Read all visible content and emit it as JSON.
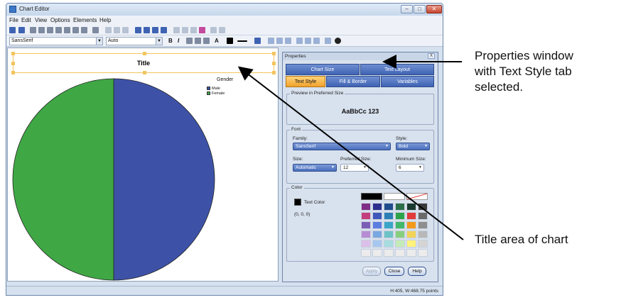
{
  "window": {
    "title": "Chart Editor",
    "controls": {
      "minimize": "–",
      "maximize": "□",
      "close": "✕"
    }
  },
  "menubar": {
    "items": [
      "File",
      "Edit",
      "View",
      "Options",
      "Elements",
      "Help"
    ]
  },
  "toolbar2": {
    "font": "SansSerif",
    "size": "Auto",
    "bold": "B",
    "italic": "I",
    "text_color_letter": "A"
  },
  "chart": {
    "title": "Title",
    "legend_title": "Gender",
    "legend_items": [
      {
        "label": "Male",
        "color": "#3d52a7"
      },
      {
        "label": "Female",
        "color": "#3fa845"
      }
    ]
  },
  "chart_data": {
    "type": "pie",
    "title": "Title",
    "categories": [
      "Male",
      "Female"
    ],
    "values": [
      50,
      50
    ],
    "colors": [
      "#3d52a7",
      "#3fa845"
    ],
    "legend_title": "Gender",
    "legend_placement": "top-right"
  },
  "properties": {
    "title": "Properties",
    "close": "X",
    "tabs": [
      "Chart Size",
      "Text Layout",
      "Text Style",
      "Fill & Border",
      "Variables"
    ],
    "selected_tab": "Text Style",
    "preview_label": "Preview in Preferred Size",
    "preview_text": "AaBbCc 123",
    "font_group": "Font",
    "family_label": "Family:",
    "family_value": "SansSerif",
    "style_label": "Style:",
    "style_value": "Bold",
    "size_label": "Size:",
    "size_value": "Automatic",
    "preferred_label": "Preferred Size:",
    "preferred_value": "12",
    "minimum_label": "Minimum Size:",
    "minimum_value": "6",
    "color_group": "Color",
    "text_color_label": "Text Color",
    "rgb": "(0, 0, 0)",
    "palette": [
      "#7e2e86",
      "#2c2f8e",
      "#1f4c8c",
      "#2a6e4a",
      "#1b3a2f",
      "#3a3a3a",
      "#c33f7d",
      "#3f57b8",
      "#2b7fb6",
      "#2ca34b",
      "#e23b3b",
      "#6a6a6a",
      "#7b5fb6",
      "#5b7de0",
      "#39a6c8",
      "#41b86a",
      "#f39a1d",
      "#8e8e8e",
      "#b78cd4",
      "#7aa8e0",
      "#6ec3c8",
      "#87cf7f",
      "#f2d35a",
      "#b8b8b8",
      "#dcc0ea",
      "#a7c7ee",
      "#a6dde0",
      "#c3ebb8",
      "#fff27d",
      "#d5d5d5",
      "#ececec",
      "#ececec",
      "#ececec",
      "#ececec",
      "#ececec",
      "#ececec"
    ],
    "buttons": {
      "apply": "Apply",
      "close": "Close",
      "help": "Help"
    }
  },
  "status": {
    "text": "H:405, W:468.75 points"
  },
  "annotations": {
    "properties": [
      "Properties window",
      "with Text Style tab",
      "selected."
    ],
    "title_area": "Title area of chart"
  }
}
